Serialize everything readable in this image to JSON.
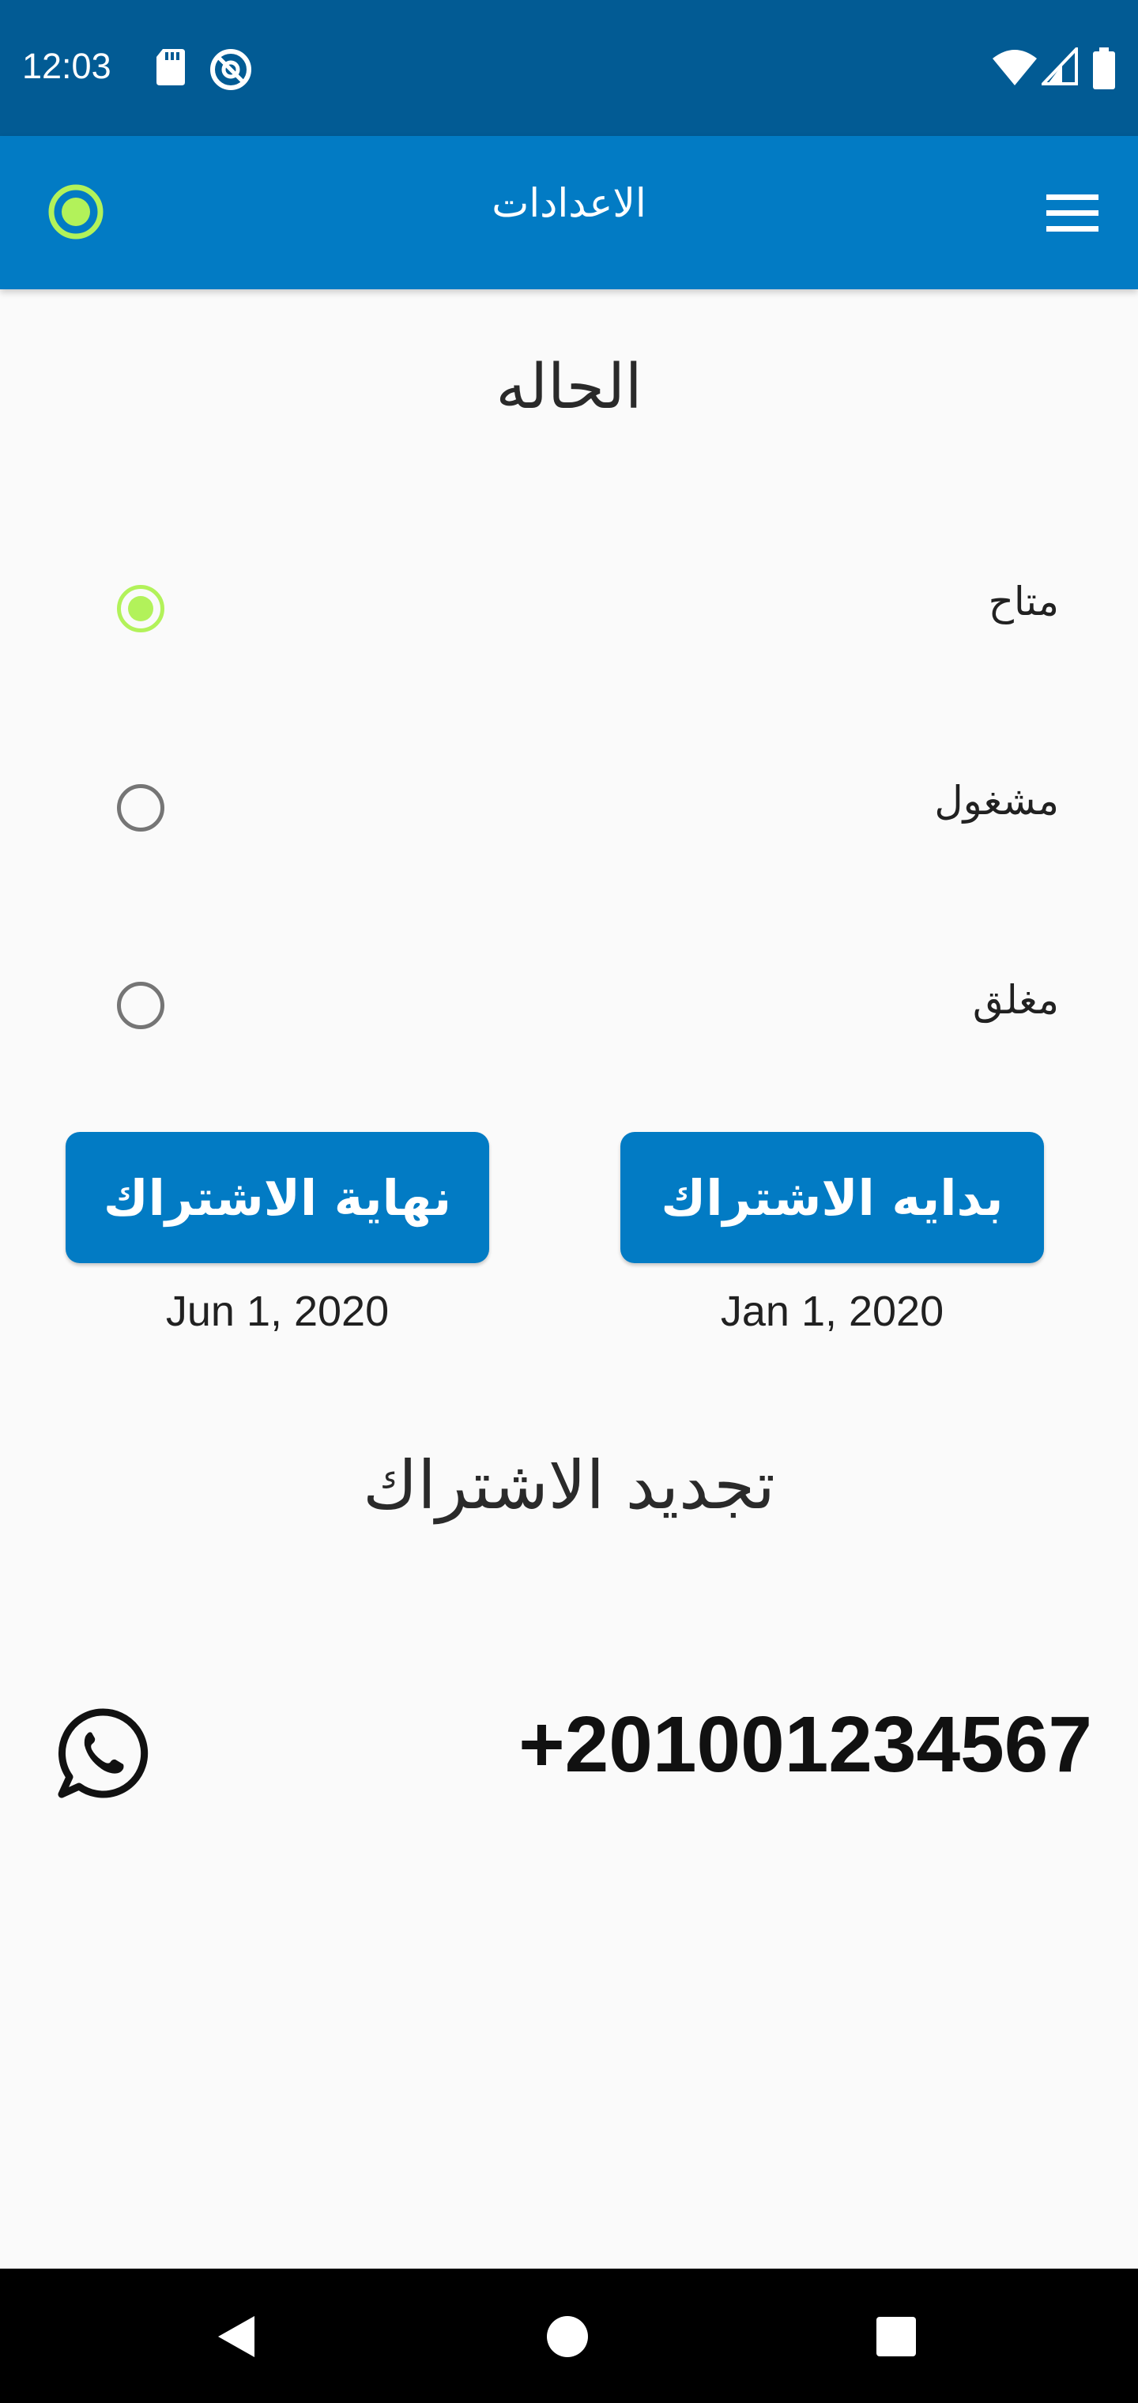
{
  "status_bar": {
    "time": "12:03",
    "left_icons": [
      "sd-card-icon",
      "do-not-disturb-icon"
    ],
    "right_icons": [
      "wifi-icon",
      "cell-signal-icon",
      "battery-icon"
    ]
  },
  "app_bar": {
    "title": "الاعدادات",
    "status_indicator_color": "#b2f25a",
    "menu_icon": "hamburger-menu-icon"
  },
  "status_section": {
    "title": "الحاله",
    "options": [
      {
        "label": "متاح",
        "selected": true
      },
      {
        "label": "مشغول",
        "selected": false
      },
      {
        "label": "مغلق",
        "selected": false
      }
    ]
  },
  "subscription": {
    "start_button": "بدايه الاشتراك",
    "start_date": "Jan 1, 2020",
    "end_button": "نهاية الاشتراك",
    "end_date": "Jun 1, 2020"
  },
  "renewal": {
    "title": "تجديد الاشتراك",
    "phone": "+201001234567",
    "contact_icon": "whatsapp-icon"
  },
  "colors": {
    "status_bar": "#025b94",
    "app_bar": "#027bc4",
    "accent_green": "#b2f25a",
    "button": "#027bc4"
  },
  "nav_bar": {
    "icons": [
      "back-icon",
      "home-icon",
      "recents-icon"
    ]
  }
}
